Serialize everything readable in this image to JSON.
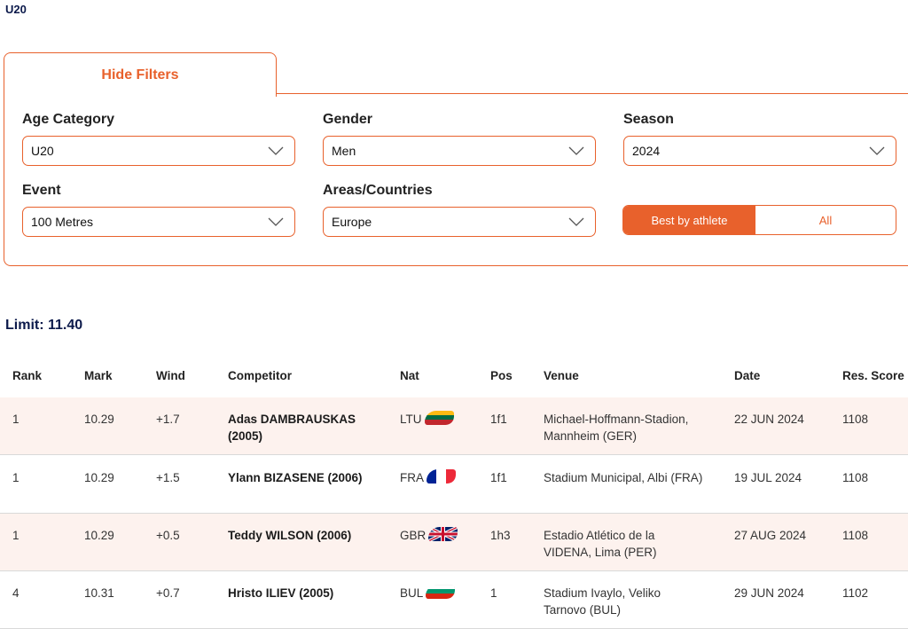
{
  "page": {
    "top_label": "U20"
  },
  "filters": {
    "hide_label": "Hide Filters",
    "age_category": {
      "label": "Age Category",
      "value": "U20"
    },
    "gender": {
      "label": "Gender",
      "value": "Men"
    },
    "season": {
      "label": "Season",
      "value": "2024"
    },
    "event": {
      "label": "Event",
      "value": "100 Metres"
    },
    "areas": {
      "label": "Areas/Countries",
      "value": "Europe"
    },
    "toggle": {
      "best": "Best by athlete",
      "all": "All"
    }
  },
  "limit": "Limit: 11.40",
  "table": {
    "headers": [
      "Rank",
      "Mark",
      "Wind",
      "Competitor",
      "Nat",
      "Pos",
      "Venue",
      "Date",
      "Res. Score"
    ],
    "rows": [
      {
        "rank": "1",
        "mark": "10.29",
        "wind": "+1.7",
        "competitor": "Adas DAMBRAUSKAS (2005)",
        "nat": "LTU",
        "flag": "lithuania-flag-icon",
        "pos": "1f1",
        "venue": "Michael-Hoffmann-Stadion, Mannheim (GER)",
        "date": "22 JUN 2024",
        "score": "1108"
      },
      {
        "rank": "1",
        "mark": "10.29",
        "wind": "+1.5",
        "competitor": "Ylann BIZASENE (2006)",
        "nat": "FRA",
        "flag": "france-flag-icon",
        "pos": "1f1",
        "venue": "Stadium Municipal, Albi (FRA)",
        "date": "19 JUL 2024",
        "score": "1108"
      },
      {
        "rank": "1",
        "mark": "10.29",
        "wind": "+0.5",
        "competitor": "Teddy WILSON (2006)",
        "nat": "GBR",
        "flag": "uk-flag-icon",
        "pos": "1h3",
        "venue": "Estadio Atlético de la VIDENA, Lima (PER)",
        "date": "27 AUG 2024",
        "score": "1108"
      },
      {
        "rank": "4",
        "mark": "10.31",
        "wind": "+0.7",
        "competitor": "Hristo ILIEV (2005)",
        "nat": "BUL",
        "flag": "bulgaria-flag-icon",
        "pos": "1",
        "venue": "Stadium Ivaylo, Veliko Tarnovo (BUL)",
        "date": "29 JUN 2024",
        "score": "1102"
      }
    ]
  },
  "colors": {
    "accent": "#e8612c",
    "navy": "#0c1a4b",
    "row_alt": "#fdf2ee"
  }
}
